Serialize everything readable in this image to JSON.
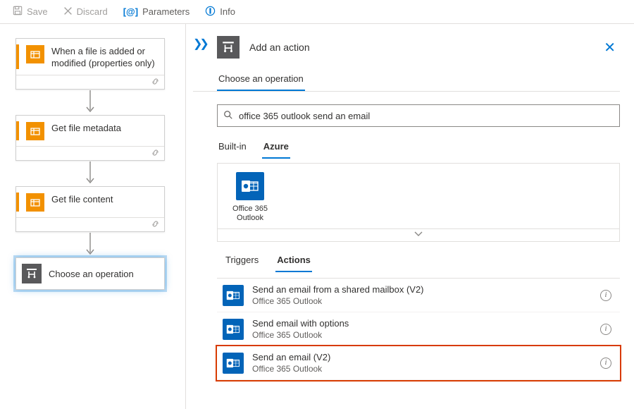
{
  "toolbar": {
    "save": "Save",
    "discard": "Discard",
    "parameters": "Parameters",
    "info": "Info"
  },
  "flow": [
    {
      "title": "When a file is added or modified (properties only)"
    },
    {
      "title": "Get file metadata"
    },
    {
      "title": "Get file content"
    }
  ],
  "choose_card": "Choose an operation",
  "pane": {
    "title": "Add an action",
    "tab1": "Choose an operation",
    "search_value": "office 365 outlook send an email",
    "filters": [
      "Built-in",
      "Azure"
    ],
    "connector": {
      "name": "Office 365 Outlook"
    },
    "ta_tabs": [
      "Triggers",
      "Actions"
    ],
    "actions": [
      {
        "name": "Send an email from a shared mailbox (V2)",
        "sub": "Office 365 Outlook"
      },
      {
        "name": "Send email with options",
        "sub": "Office 365 Outlook"
      },
      {
        "name": "Send an email (V2)",
        "sub": "Office 365 Outlook"
      }
    ]
  }
}
